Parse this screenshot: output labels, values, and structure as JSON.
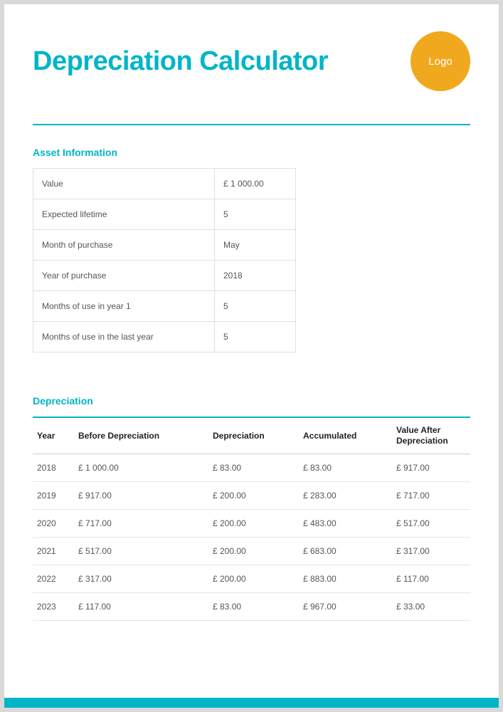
{
  "title": "Depreciation Calculator",
  "logo_text": "Logo",
  "asset_info": {
    "heading": "Asset Information",
    "rows": [
      {
        "label": "Value",
        "value": "£ 1 000.00"
      },
      {
        "label": "Expected lifetime",
        "value": "5"
      },
      {
        "label": "Month of purchase",
        "value": "May"
      },
      {
        "label": "Year of purchase",
        "value": "2018"
      },
      {
        "label": "Months of use in year 1",
        "value": "5"
      },
      {
        "label": "Months of use in the last year",
        "value": "5"
      }
    ]
  },
  "depreciation": {
    "heading": "Depreciation",
    "columns": [
      "Year",
      "Before Depreciation",
      "Depreciation",
      "Accumulated",
      "Value After Depreciation"
    ],
    "rows": [
      {
        "year": "2018",
        "before": "£ 1 000.00",
        "dep": "£ 83.00",
        "acc": "£ 83.00",
        "after": "£ 917.00"
      },
      {
        "year": "2019",
        "before": "£ 917.00",
        "dep": "£ 200.00",
        "acc": "£ 283.00",
        "after": "£ 717.00"
      },
      {
        "year": "2020",
        "before": "£ 717.00",
        "dep": "£ 200.00",
        "acc": "£ 483.00",
        "after": "£ 517.00"
      },
      {
        "year": "2021",
        "before": "£ 517.00",
        "dep": "£ 200.00",
        "acc": "£ 683.00",
        "after": "£ 317.00"
      },
      {
        "year": "2022",
        "before": "£ 317.00",
        "dep": "£ 200.00",
        "acc": "£ 883.00",
        "after": "£ 117.00"
      },
      {
        "year": "2023",
        "before": "£ 117.00",
        "dep": "£ 83.00",
        "acc": "£ 967.00",
        "after": "£ 33.00"
      }
    ]
  }
}
